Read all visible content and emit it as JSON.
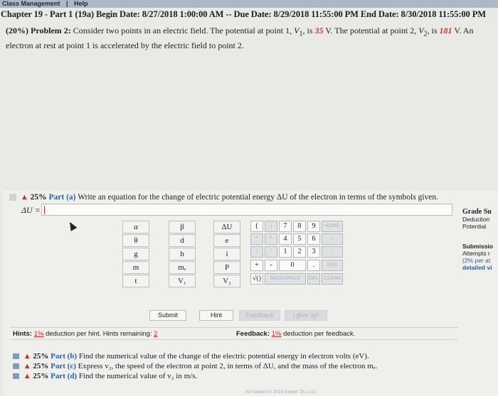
{
  "menubar": {
    "item1": "Class Management",
    "sep": "|",
    "item2": "Help"
  },
  "header": {
    "chapter_line": "Chapter 19 - Part 1 (19a) Begin Date: 8/27/2018 1:00:00 AM -- Due Date: 8/29/2018 11:55:00 PM End Date: 8/30/2018 11:55:00 PM"
  },
  "problem": {
    "weight": "(20%)",
    "label": "Problem 2:",
    "text_a": "Consider two points in an electric field. The potential at point 1,",
    "v1_sym": "V",
    "v1_sub": "1",
    "text_b": ", is",
    "v1_value": "35",
    "text_c": "V. The potential at point 2,",
    "v2_sym": "V",
    "v2_sub": "2",
    "text_d": ", is",
    "v2_value": "181",
    "text_e": "V. An electron at rest at point 1 is accelerated by the electric field to point 2."
  },
  "part_a": {
    "weight": "25%",
    "label": "Part (a)",
    "text": "Write an equation for the change of electric potential energy ΔU of the electron in terms of the symbols given."
  },
  "answer": {
    "label": "ΔU =",
    "value": ""
  },
  "sidebar": {
    "l1": "Grade Su",
    "l2": "Deduction",
    "l3": "Potential",
    "l4": "Submissio",
    "l5": "Attempts r",
    "l6": "(2% per at",
    "l7": "detailed vi"
  },
  "symbols": {
    "c1": [
      "α",
      "θ",
      "g",
      "m",
      "t"
    ],
    "c2": [
      "β",
      "d",
      "h",
      "mₑ",
      "V₁"
    ],
    "c3": [
      "ΔU",
      "e",
      "i",
      "P",
      "V₂"
    ]
  },
  "keypad": {
    "r1": [
      "(",
      ")",
      "7",
      "8",
      "9",
      "HOME"
    ],
    "r2": [
      "^",
      "^",
      "4",
      "5",
      "6",
      "←"
    ],
    "r3": [
      "/",
      "*",
      "1",
      "2",
      "3",
      "→"
    ],
    "r4": [
      "+",
      "-",
      "0",
      ".",
      "END"
    ],
    "r5": [
      "√()",
      "BACKSPACE",
      "DEL",
      "CLEAR"
    ]
  },
  "buttons": {
    "submit": "Submit",
    "hint": "Hint",
    "feedback": "Feedback",
    "giveup": "I give up!"
  },
  "hints": {
    "label": "Hints:",
    "pct": "1%",
    "text": "deduction per hint. Hints remaining:",
    "remaining": "2"
  },
  "feedback": {
    "label": "Feedback:",
    "pct": "1%",
    "text": "deduction per feedback."
  },
  "parts": {
    "b": {
      "weight": "25%",
      "label": "Part (b)",
      "text": "Find the numerical value of the change of the electric potential energy in electron volts (eV)."
    },
    "c": {
      "weight": "25%",
      "label": "Part (c)",
      "text": "Express v₂, the speed of the electron at point 2, in terms of ΔU, and the mass of the electron mₑ."
    },
    "d": {
      "weight": "25%",
      "label": "Part (d)",
      "text": "Find the numerical value of v₂ in m/s."
    }
  },
  "footer": "All content © 2018 Expert TA, LLC"
}
